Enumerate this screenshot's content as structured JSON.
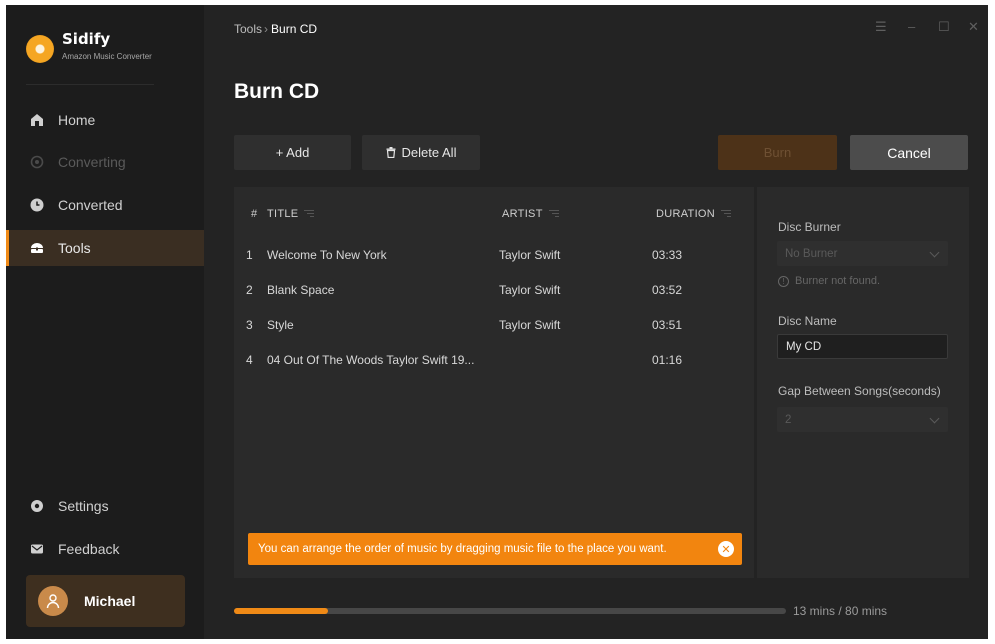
{
  "app": {
    "name": "Sidify",
    "subtitle": "Amazon Music Converter"
  },
  "sidebar": {
    "items": [
      {
        "label": "Home",
        "icon": "home-icon",
        "state": "normal"
      },
      {
        "label": "Converting",
        "icon": "converting-icon",
        "state": "disabled"
      },
      {
        "label": "Converted",
        "icon": "clock-icon",
        "state": "normal"
      },
      {
        "label": "Tools",
        "icon": "toolbox-icon",
        "state": "active"
      }
    ],
    "bottom": [
      {
        "label": "Settings",
        "icon": "gear-icon"
      },
      {
        "label": "Feedback",
        "icon": "mail-icon"
      }
    ],
    "user": {
      "name": "Michael",
      "icon": "user-icon"
    }
  },
  "breadcrumb": {
    "parent": "Tools",
    "separator": "›",
    "current": "Burn CD"
  },
  "window_controls": {
    "menu": "☰",
    "minimize": "–",
    "maximize": "☐",
    "close": "✕"
  },
  "page": {
    "title": "Burn CD"
  },
  "toolbar": {
    "add_label": "+ Add",
    "delete_label": "Delete All",
    "burn_label": "Burn",
    "cancel_label": "Cancel"
  },
  "table": {
    "headers": {
      "num": "#",
      "title": "TITLE",
      "artist": "ARTIST",
      "duration": "DURATION"
    },
    "rows": [
      {
        "num": "1",
        "title": "Welcome To New York",
        "artist": "Taylor Swift",
        "duration": "03:33"
      },
      {
        "num": "2",
        "title": "Blank Space",
        "artist": "Taylor Swift",
        "duration": "03:52"
      },
      {
        "num": "3",
        "title": "Style",
        "artist": "Taylor Swift",
        "duration": "03:51"
      },
      {
        "num": "4",
        "title": "04 Out Of The Woods Taylor Swift 19...",
        "artist": "",
        "duration": "01:16"
      }
    ],
    "hint": "You can arrange the order of music by dragging music file to the place you want."
  },
  "settings": {
    "disc_burner_label": "Disc Burner",
    "disc_burner_value": "No Burner",
    "burner_warning": "Burner not found.",
    "disc_name_label": "Disc Name",
    "disc_name_value": "My CD",
    "gap_label": "Gap Between Songs(seconds)",
    "gap_value": "2"
  },
  "progress": {
    "used_fraction": 0.17,
    "text": "13 mins / 80 mins"
  },
  "colors": {
    "accent": "#f08a16",
    "hint_bg": "#f2850f",
    "background": "#232323",
    "sidebar": "#1c1c1c"
  }
}
